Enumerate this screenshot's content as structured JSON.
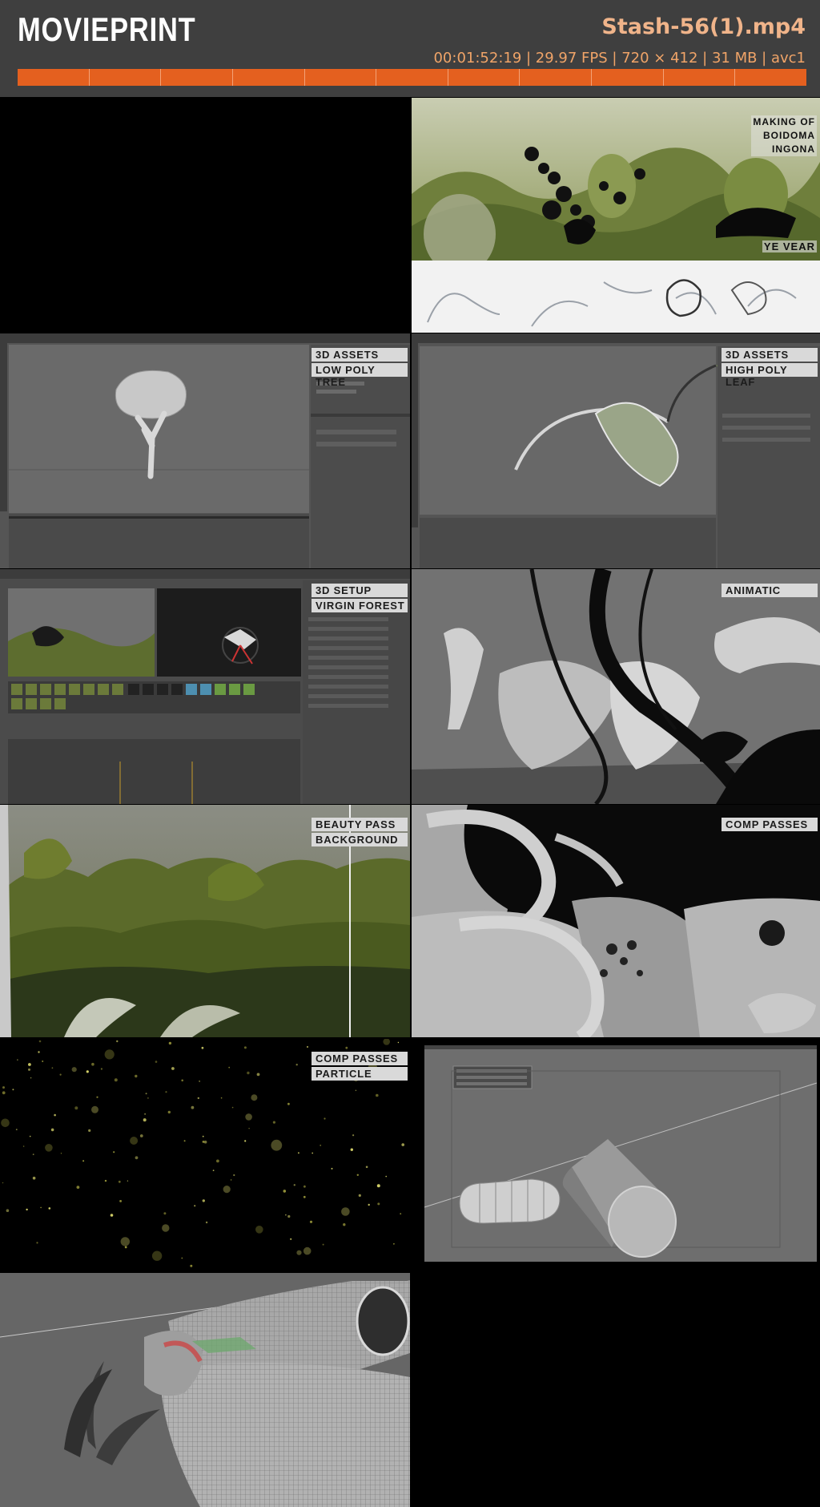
{
  "app": {
    "logo": "MOVIEPRINT",
    "file_title": "Stash-56(1).mp4",
    "file_meta": "00:01:52:19 | 29.97 FPS | 720 × 412 | 31 MB | avc1",
    "timeline_segments": 11
  },
  "colors": {
    "header_bg": "#3f3f3f",
    "accent_orange": "#e4601f",
    "title_color": "#f0b48a",
    "label_bg": "#d9d9d9"
  },
  "thumbs": {
    "t2": {
      "overlay_top": "MAKING OF\nBOIDOMA\nINGONA",
      "overlay_line1": "MAKING OF",
      "overlay_line2": "BOIDOMA",
      "overlay_line3": "INGONA",
      "overlay_bottom": "YE VEAR"
    },
    "t3": {
      "label1": "3D ASSETS",
      "label2": "LOW POLY TREE"
    },
    "t4": {
      "label1": "3D ASSETS",
      "label2": "HIGH POLY LEAF"
    },
    "t5": {
      "label1": "3D SETUP",
      "label2": "VIRGIN FOREST"
    },
    "t6": {
      "label1": "ANIMATIC"
    },
    "t7": {
      "label1": "BEAUTY PASS",
      "label2": "BACKGROUND"
    },
    "t8": {
      "label1": "COMP PASSES"
    },
    "t9": {
      "label1": "COMP PASSES",
      "label2": "PARTICLE"
    }
  }
}
